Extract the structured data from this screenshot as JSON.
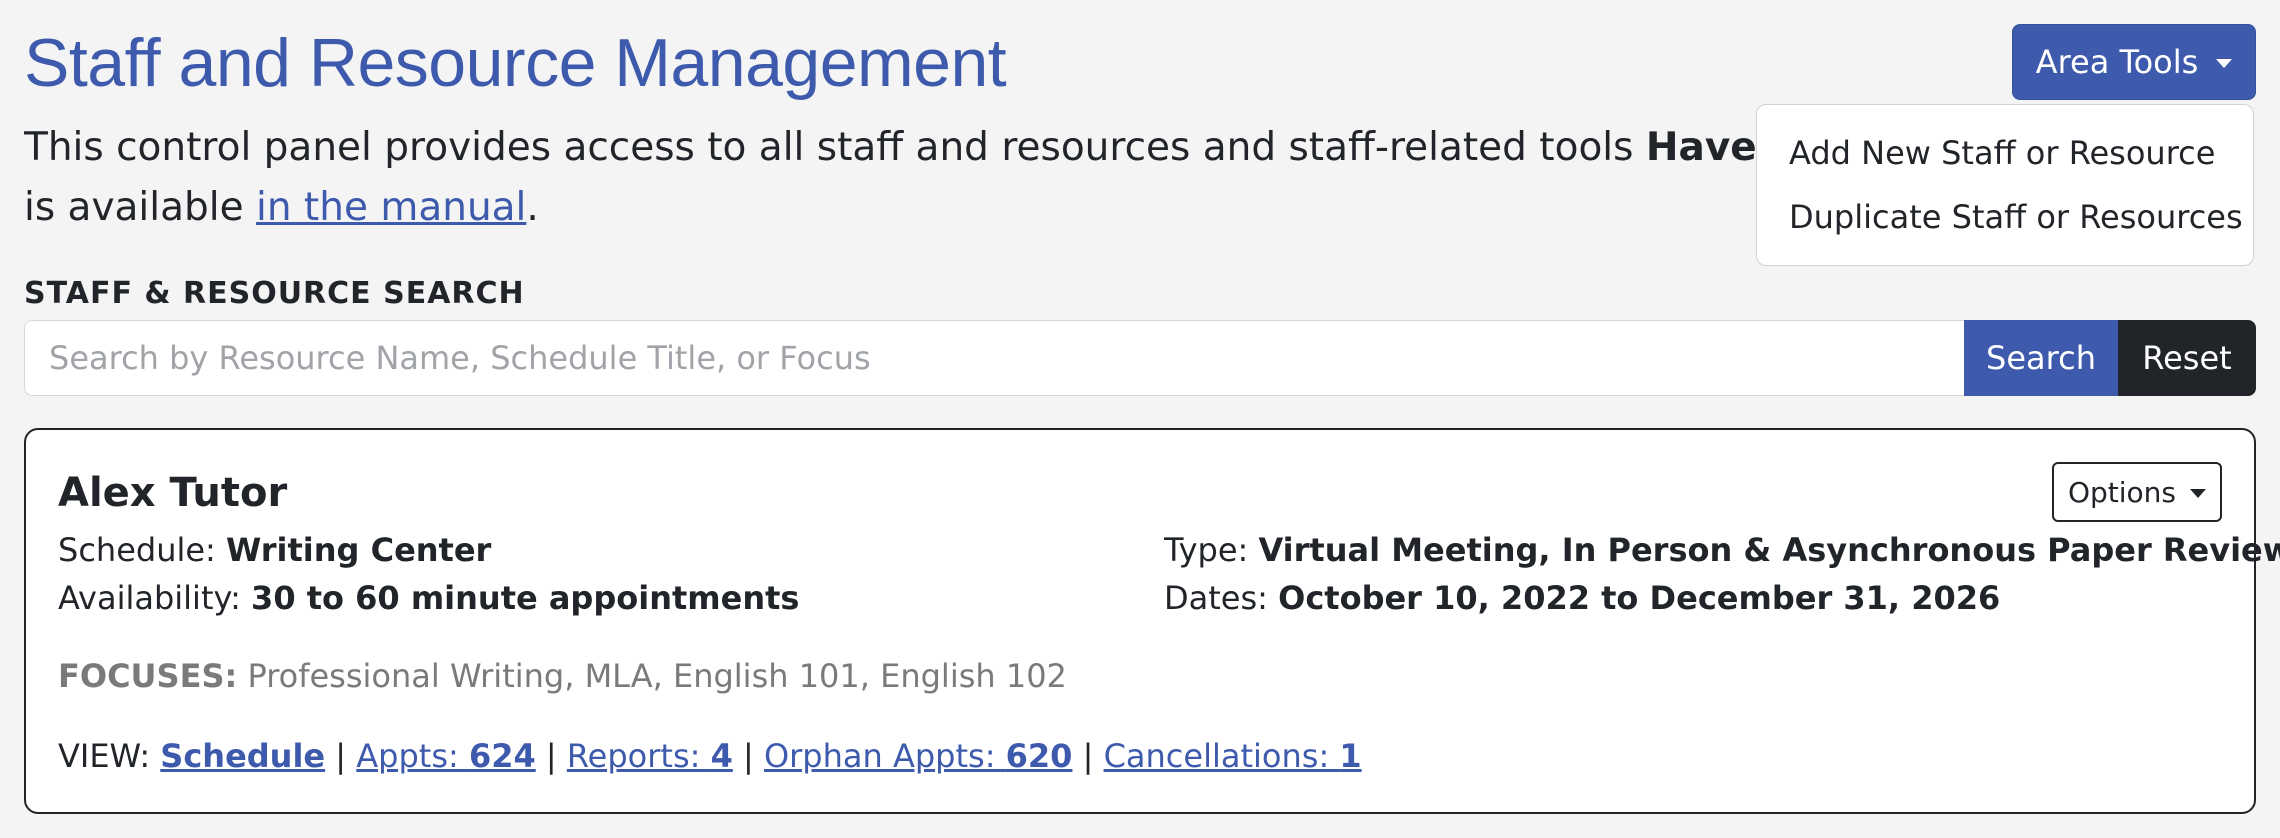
{
  "header": {
    "title": "Staff and Resource Management",
    "area_tools_label": "Area Tools"
  },
  "intro": {
    "text_before": "This control panel provides access to all staff and resources and staff-related tools ",
    "bold_text": "Have que",
    "line2_before": "is available ",
    "manual_link": "in the manual",
    "line2_after": "."
  },
  "area_tools_menu": {
    "items": [
      {
        "label": "Add New Staff or Resource"
      },
      {
        "label": "Duplicate Staff or Resources"
      }
    ]
  },
  "search": {
    "label": "STAFF & RESOURCE SEARCH",
    "placeholder": "Search by Resource Name, Schedule Title, or Focus",
    "value": "",
    "search_button": "Search",
    "reset_button": "Reset"
  },
  "resource_card": {
    "name": "Alex Tutor",
    "options_label": "Options",
    "schedule_label": "Schedule: ",
    "schedule_value": "Writing Center",
    "availability_label": "Availability: ",
    "availability_value": "30 to 60 minute appointments",
    "type_label": "Type: ",
    "type_value": "Virtual Meeting, In Person & Asynchronous Paper Review",
    "dates_label": "Dates: ",
    "dates_value": "October 10, 2022 to December 31, 2026",
    "focuses_label": "FOCUSES:",
    "focuses_value": " Professional Writing, MLA, English 101, English 102",
    "view_label": "VIEW: ",
    "separator": " | ",
    "links": {
      "schedule": "Schedule",
      "appts_label": "Appts: ",
      "appts_value": "624",
      "reports_label": "Reports: ",
      "reports_value": "4",
      "orphan_label": "Orphan Appts: ",
      "orphan_value": "620",
      "cancellations_label": "Cancellations: ",
      "cancellations_value": "1"
    }
  },
  "colors": {
    "primary": "#3d5aad",
    "dark": "#212529",
    "muted": "#7a7a7a",
    "background": "#f4f4f4"
  },
  "icons": {
    "dropdown_caret": "caret-down-icon"
  }
}
